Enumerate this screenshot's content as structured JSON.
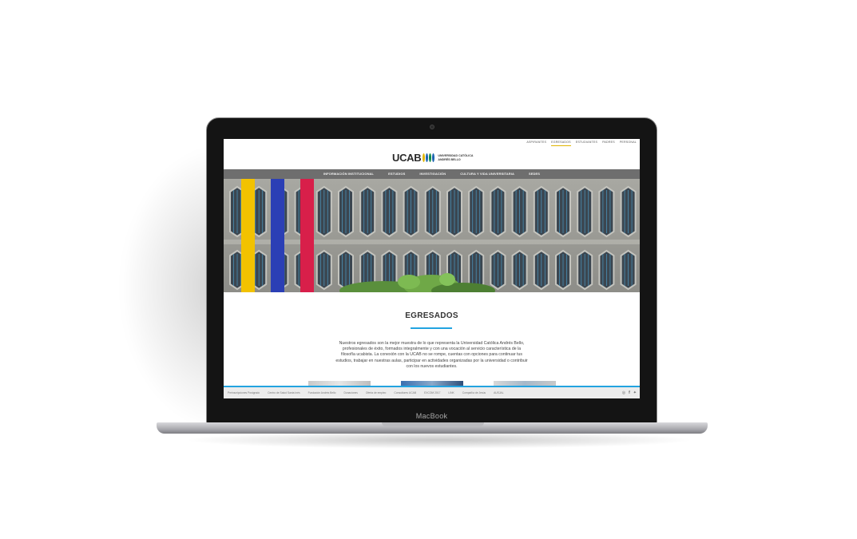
{
  "device": {
    "label": "MacBook"
  },
  "site": {
    "top_links": [
      "ASPIRANTES",
      "EGRESADOS",
      "ESTUDIANTES",
      "PADRES",
      "PERSONAL"
    ],
    "active_top_link": "EGRESADOS",
    "logo": {
      "abbrev": "UCAB",
      "line1": "UNIVERSIDAD CATÓLICA",
      "line2": "ANDRÉS BELLO",
      "leaf_colors": [
        "#e0b400",
        "#1c63b0",
        "#0f8b45",
        "#1c63b0"
      ]
    },
    "nav": [
      "INFORMACIÓN INSTITUCIONAL",
      "ESTUDIOS",
      "INVESTIGACIÓN",
      "CULTURA Y VIDA UNIVERSITARIA",
      "SEDES"
    ],
    "hero": {
      "banner_colors": [
        "#f2c200",
        "#2b3fb5",
        "#d81f4a"
      ]
    },
    "section_title": "EGRESADOS",
    "body_text": "Nuestros egresados son la mejor muestra de lo que representa la Universidad Católica Andrés Bello, profesionales de éxito, formados integralmente y con una vocación al servicio característica de la filosofía ucabista. La conexión con la UCAB no se rompe, cuentas con opciones para continuar tus estudios, trabajar en nuestras aulas, participar en actividades organizadas por la universidad o contribuir con los nuevos estudiantes.",
    "footer_links": [
      "Preinscripciones Postgrado",
      "Centro de Salud Santa Inés",
      "Fundación Andrés Bello",
      "Donaciones",
      "Oferta de empleo",
      "Consultores UCAB",
      "EXCOM 2017",
      "LINK",
      "Compañía de Jesús",
      "AUSJAL"
    ],
    "socials": [
      "instagram-icon",
      "facebook-icon",
      "twitter-icon"
    ],
    "accent_color": "#22a3e0"
  }
}
